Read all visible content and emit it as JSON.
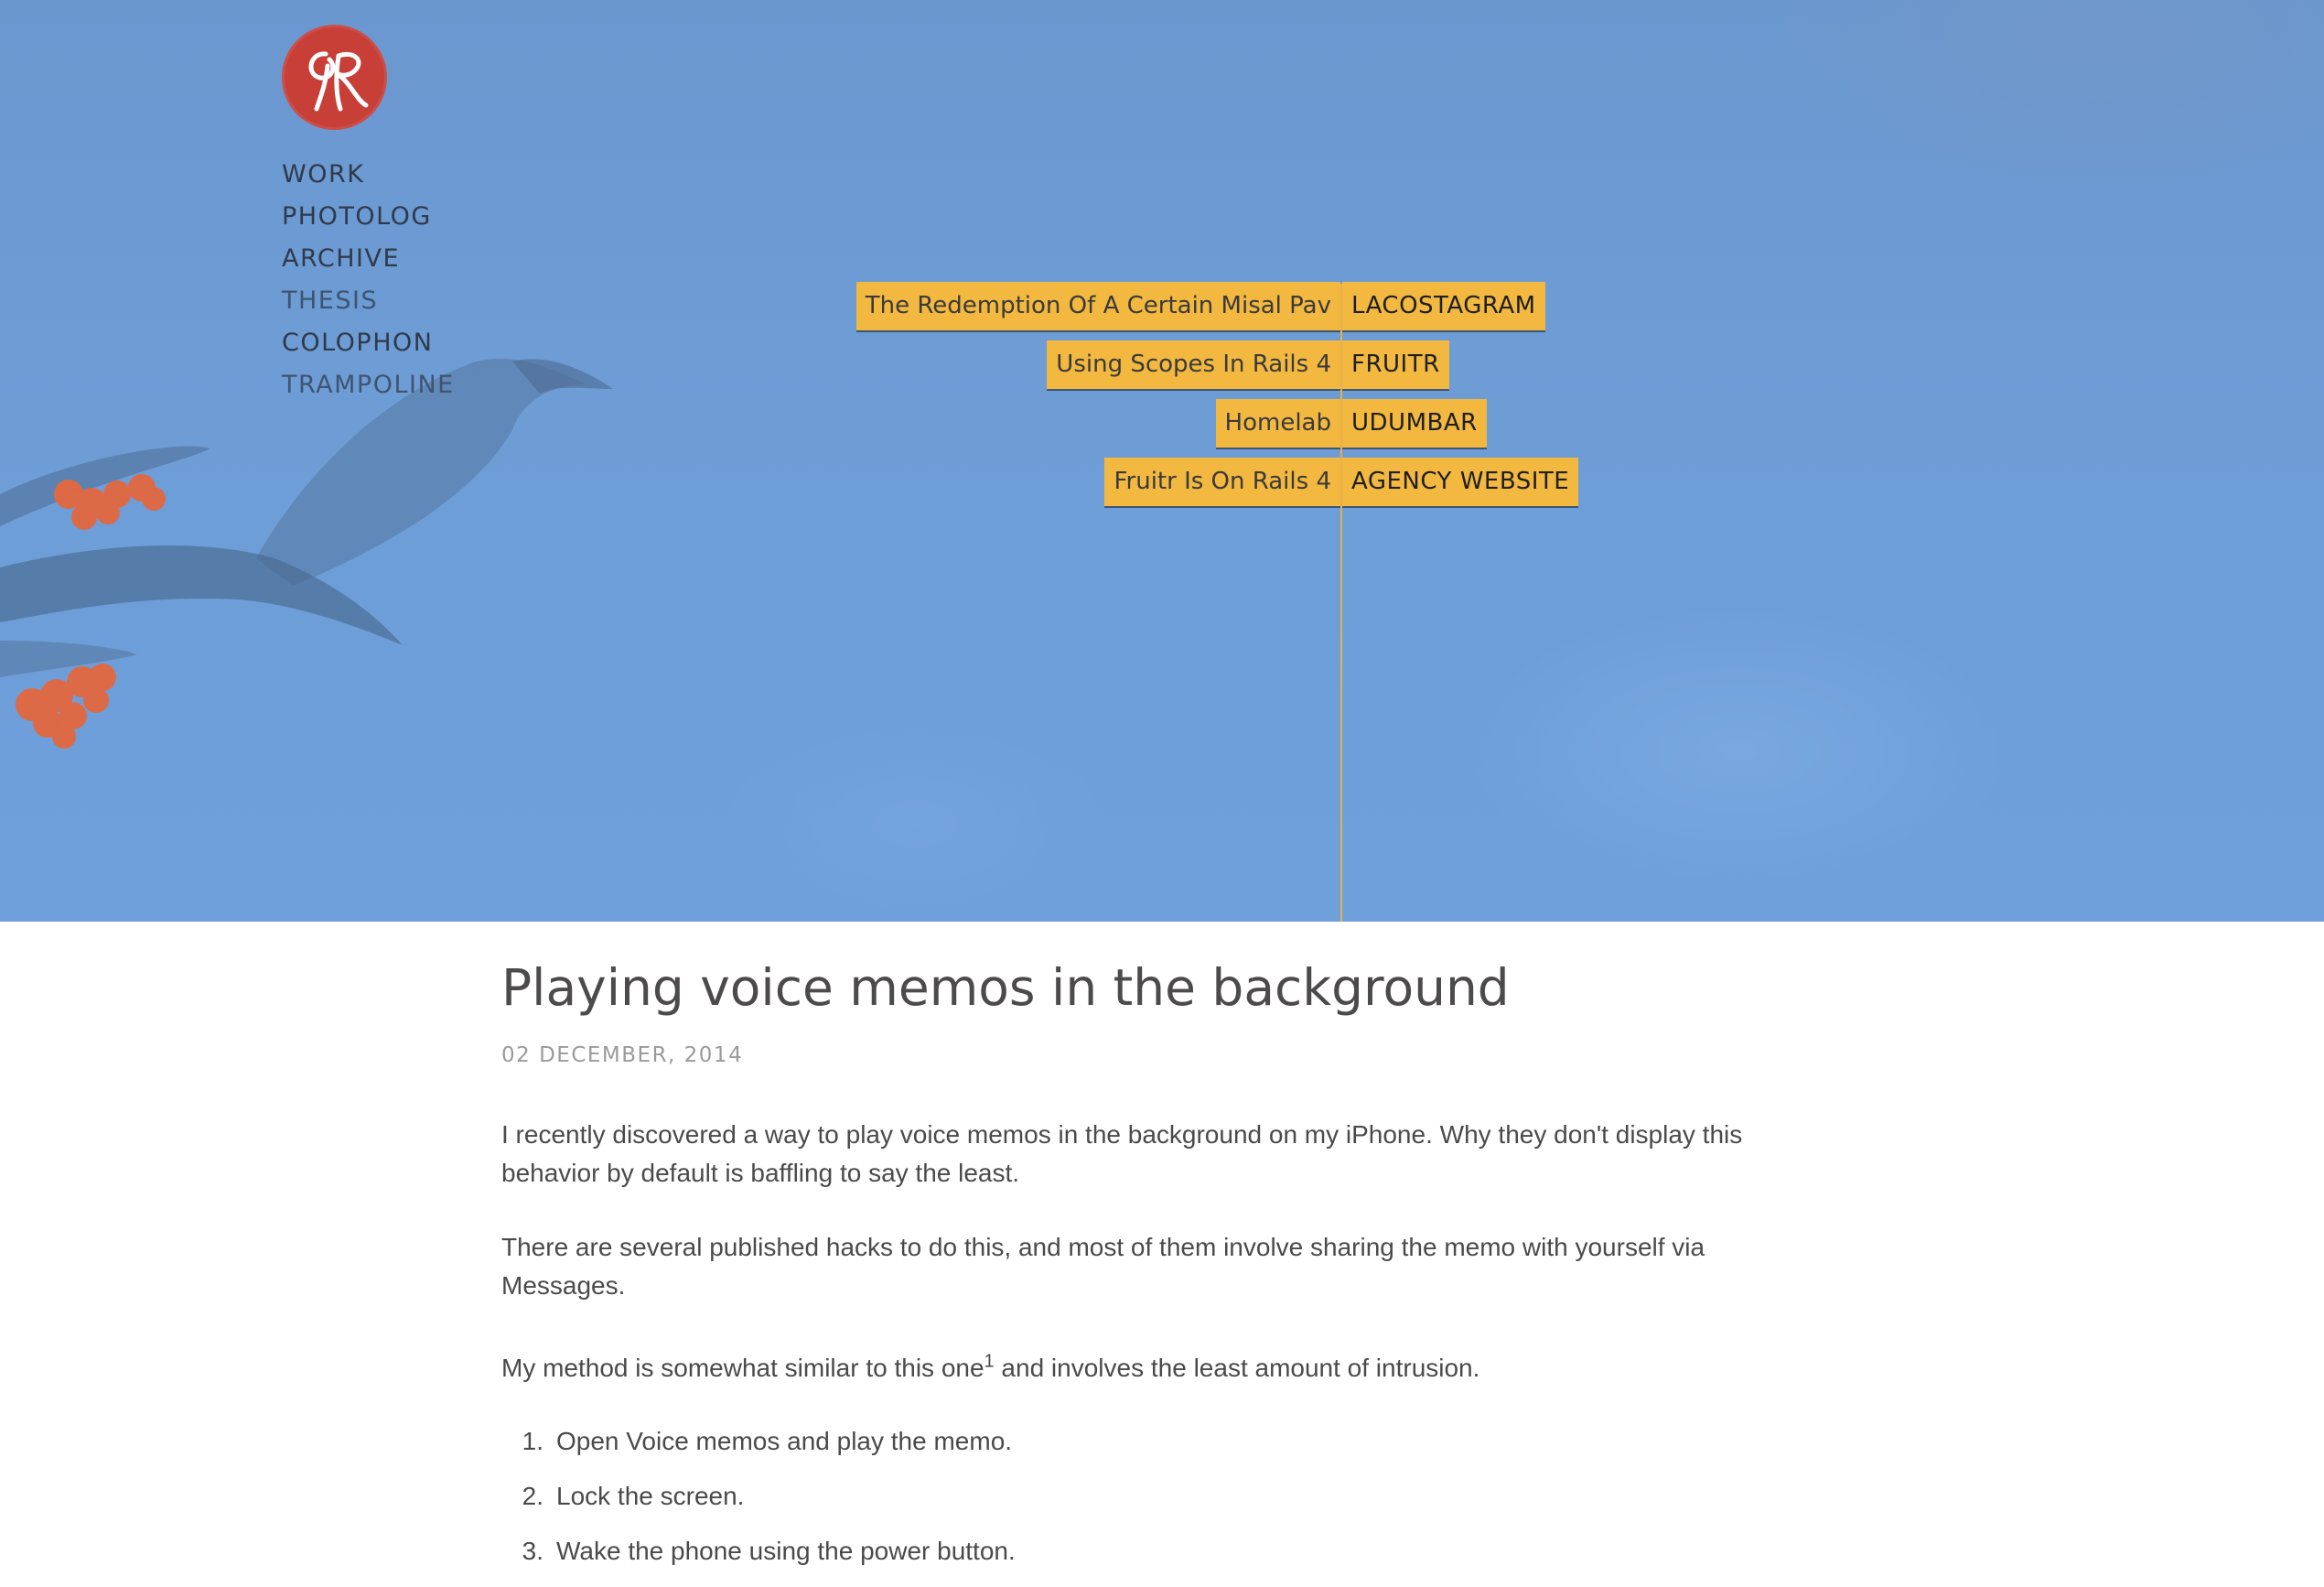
{
  "site": {
    "logo_alt": "site logo monogram",
    "nav": [
      {
        "label": "WORK"
      },
      {
        "label": "PHOTOLOG"
      },
      {
        "label": "ARCHIVE"
      },
      {
        "label": "THESIS"
      },
      {
        "label": "COLOPHON"
      },
      {
        "label": "TRAMPOLINE"
      }
    ]
  },
  "timeline": {
    "rows": [
      {
        "post": "The Redemption Of A Certain Misal Pav",
        "project": "LACOSTAGRAM"
      },
      {
        "post": "Using Scopes In Rails 4",
        "project": "FRUITR"
      },
      {
        "post": "Homelab",
        "project": "UDUMBAR"
      },
      {
        "post": "Fruitr Is On Rails 4",
        "project": "AGENCY WEBSITE"
      }
    ]
  },
  "article": {
    "title": "Playing voice memos in the background",
    "date": "02 DECEMBER, 2014",
    "paragraphs": [
      "I recently discovered a way to play voice memos in the background on my iPhone. Why they don't display this behavior by default is baffling to say the least.",
      "There are several published hacks to do this, and most of them involve sharing the memo with yourself via Messages."
    ],
    "p3_before": "My method is somewhat similar to this one",
    "p3_footnote": "1",
    "p3_after": " and involves the least amount of intrusion.",
    "steps": [
      {
        "num": "1.",
        "text": "Open Voice memos and play the memo."
      },
      {
        "num": "2.",
        "text": "Lock the screen."
      },
      {
        "num": "3.",
        "text": "Wake the phone using the power button."
      }
    ]
  },
  "colors": {
    "hero_blue": "#6e9dd6",
    "accent_yellow": "#f2b840",
    "logo_red": "#c83f38"
  }
}
